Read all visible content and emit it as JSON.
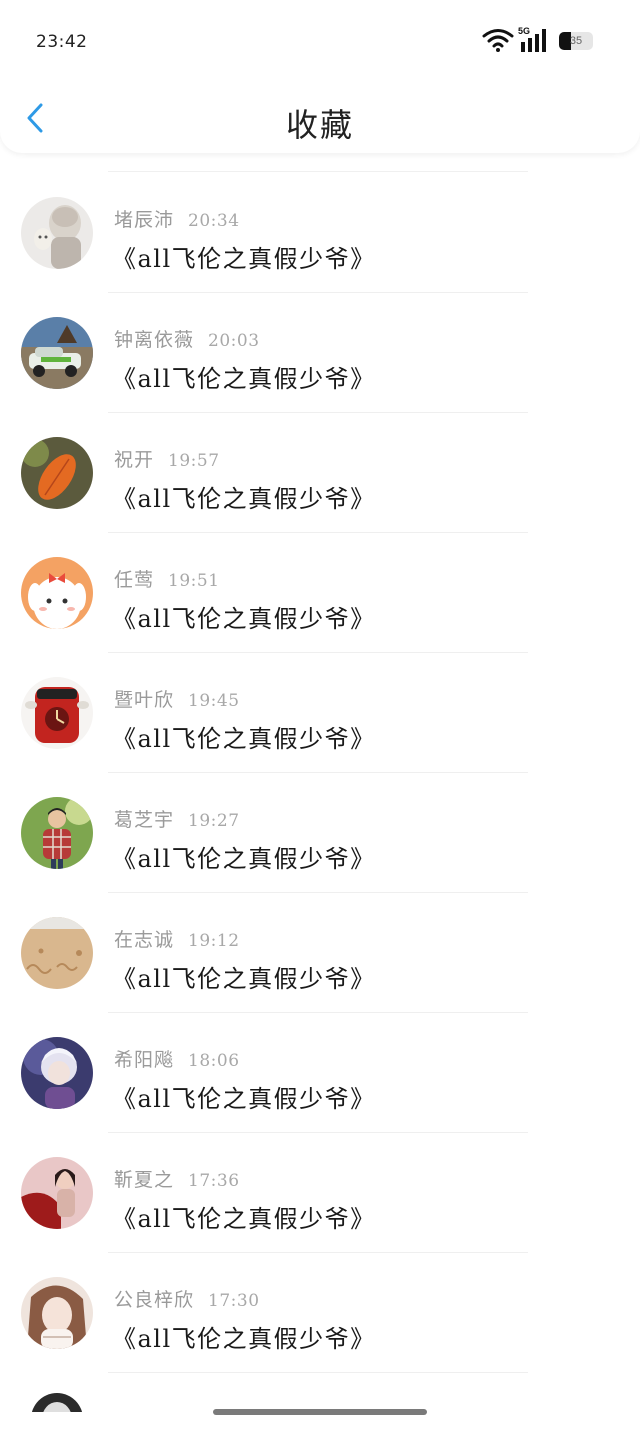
{
  "status_bar": {
    "time": "23:42",
    "network": "5G",
    "battery": "35",
    "battery_level": 0.35
  },
  "header": {
    "title": "收藏",
    "accent_color": "#2e9ae6"
  },
  "favorites": [
    {
      "name": "堵辰沛",
      "time": "20:34",
      "message": "《all飞伦之真假少爷》",
      "avatar": "anime-boy-with-cat"
    },
    {
      "name": "钟离依薇",
      "time": "20:03",
      "message": "《all飞伦之真假少爷》",
      "avatar": "rally-car"
    },
    {
      "name": "祝开",
      "time": "19:57",
      "message": "《all飞伦之真假少爷》",
      "avatar": "autumn-leaf"
    },
    {
      "name": "任莺",
      "time": "19:51",
      "message": "《all飞伦之真假少爷》",
      "avatar": "cartoon-dog-with-bow"
    },
    {
      "name": "暨叶欣",
      "time": "19:45",
      "message": "《all飞伦之真假少爷》",
      "avatar": "red-alarm-clock-toy"
    },
    {
      "name": "葛芝宇",
      "time": "19:27",
      "message": "《all飞伦之真假少爷》",
      "avatar": "boy-plaid-shirt"
    },
    {
      "name": "在志诚",
      "time": "19:12",
      "message": "《all飞伦之真假少爷》",
      "avatar": "sand-writing"
    },
    {
      "name": "希阳飚",
      "time": "18:06",
      "message": "《all飞伦之真假少爷》",
      "avatar": "anime-white-hair"
    },
    {
      "name": "靳夏之",
      "time": "17:36",
      "message": "《all飞伦之真假少爷》",
      "avatar": "girl-red-fabric"
    },
    {
      "name": "公良梓欣",
      "time": "17:30",
      "message": "《all飞伦之真假少爷》",
      "avatar": "girl-soft-portrait"
    }
  ]
}
